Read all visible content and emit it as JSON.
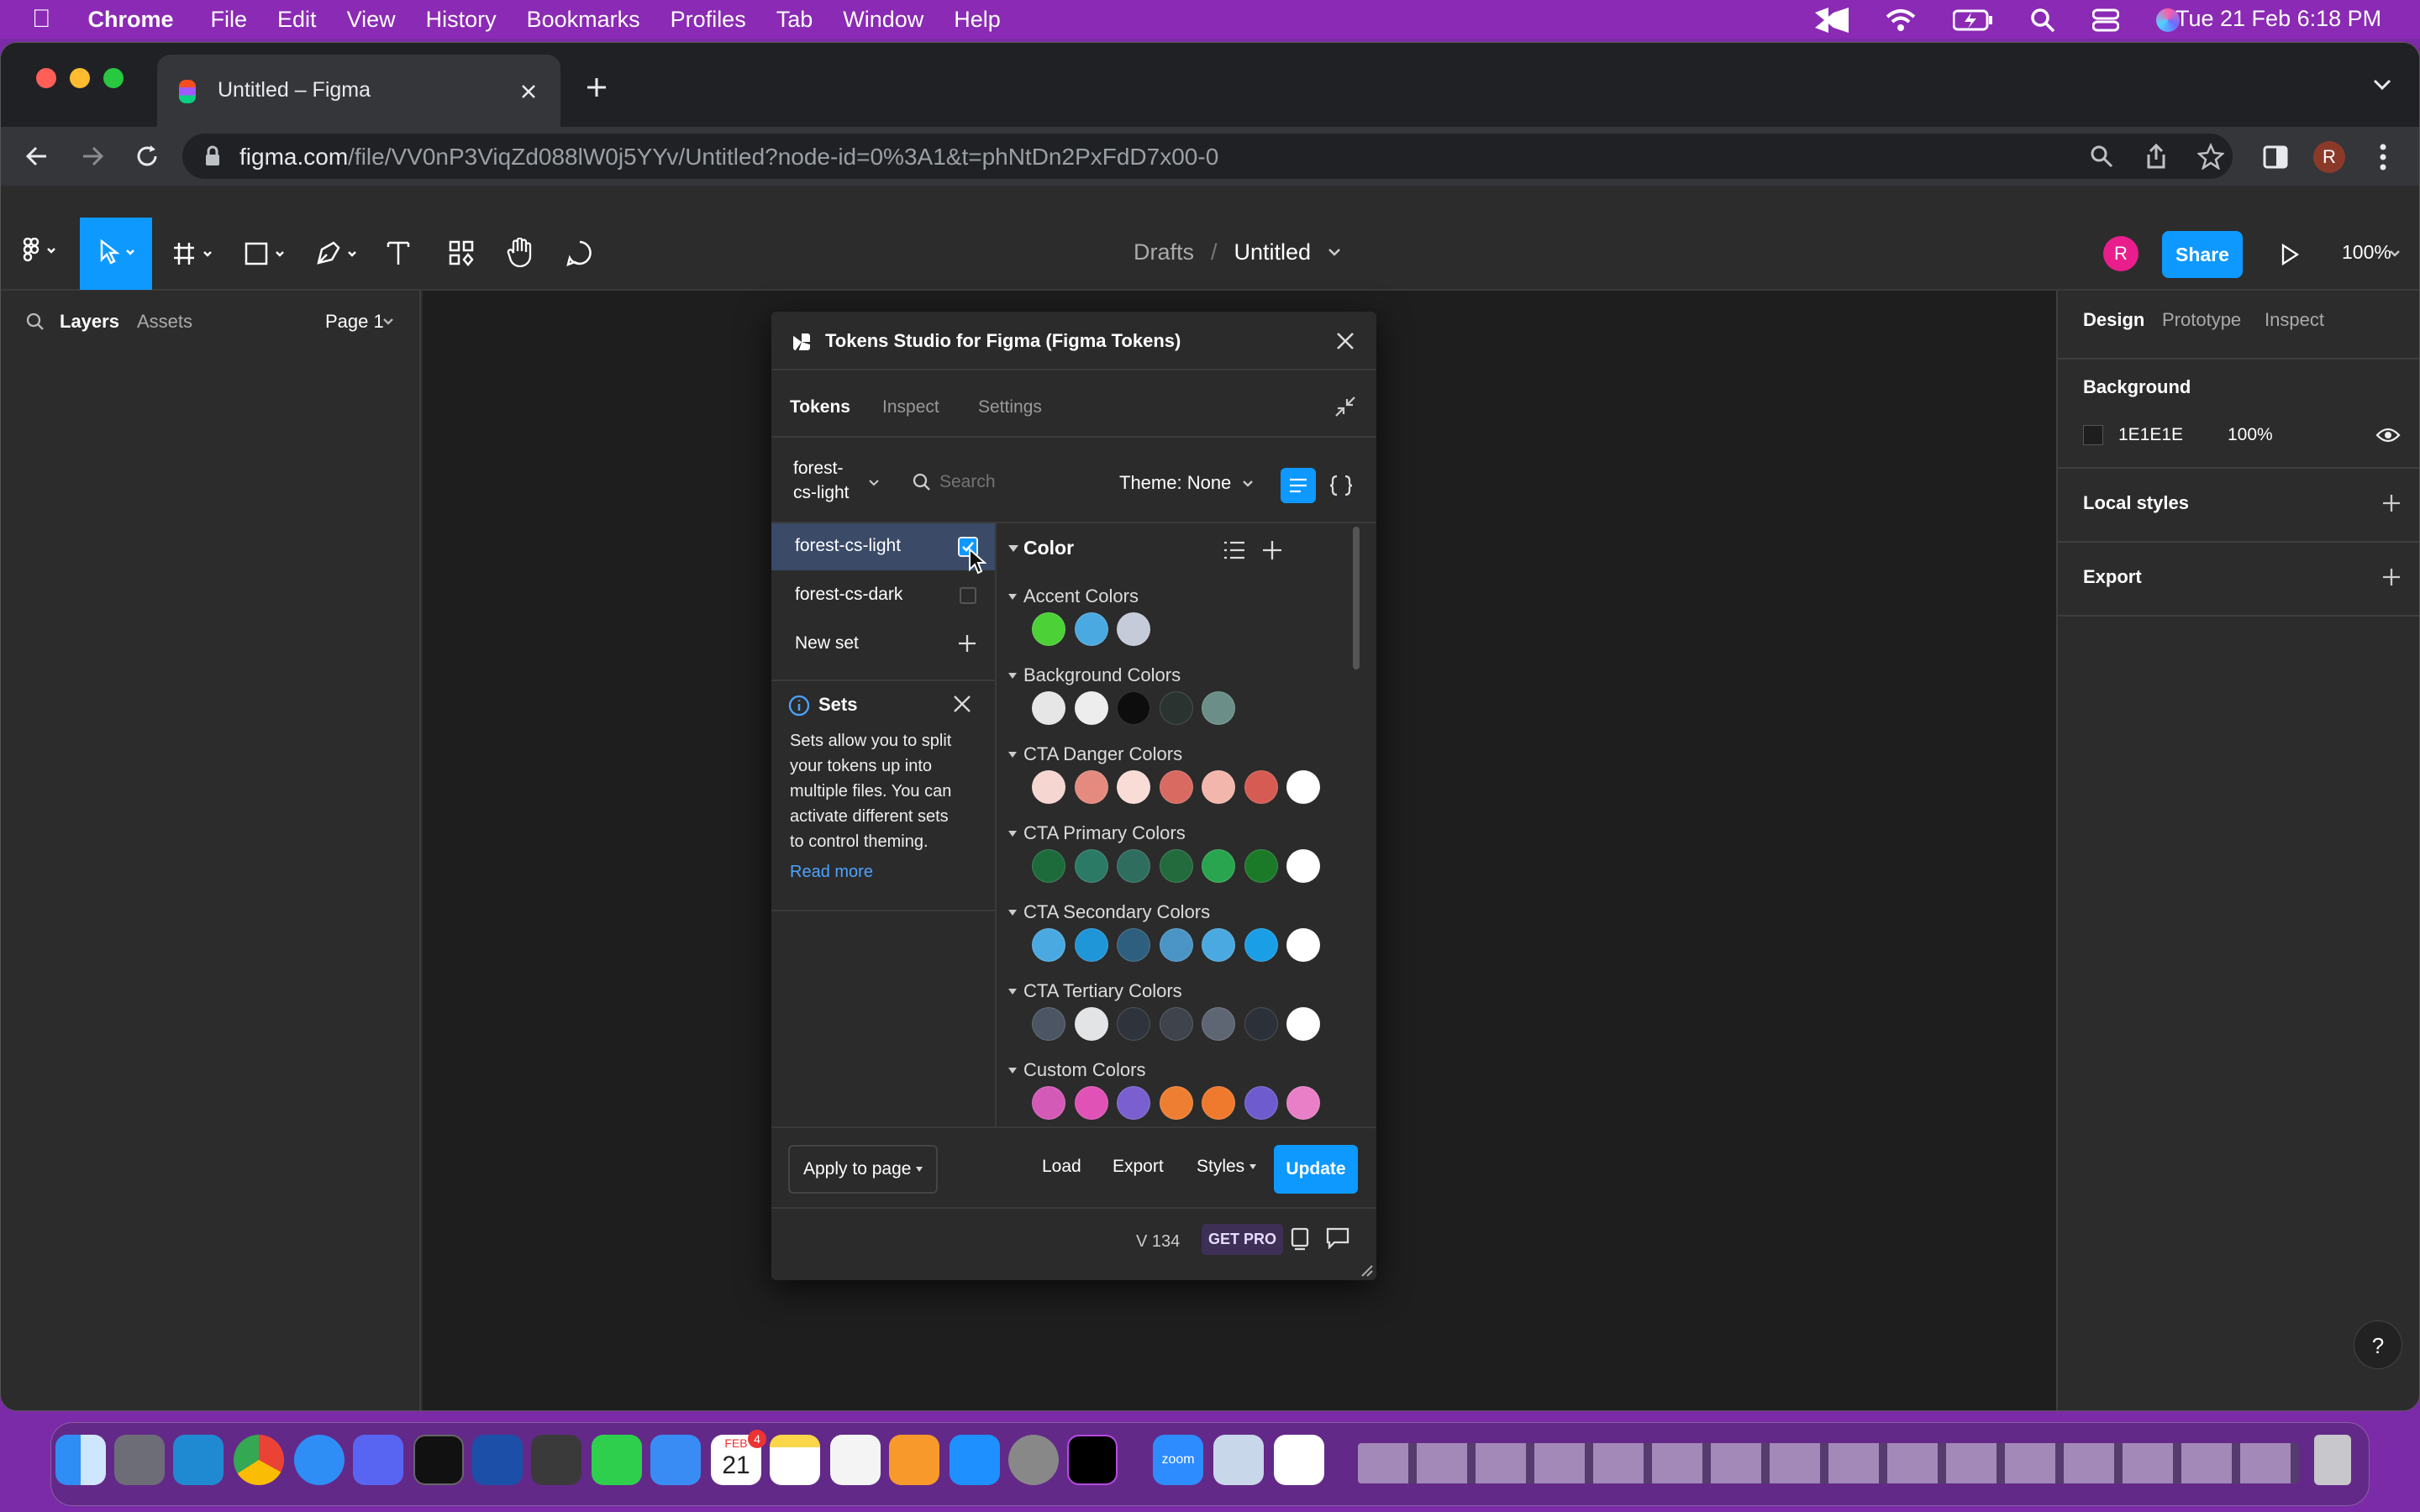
{
  "menubar": {
    "app": "Chrome",
    "items": [
      "File",
      "Edit",
      "View",
      "History",
      "Bookmarks",
      "Profiles",
      "Tab",
      "Window",
      "Help"
    ],
    "datetime": "Tue 21 Feb  6:18 PM"
  },
  "browser": {
    "tab_title": "Untitled – Figma",
    "url_domain": "figma.com",
    "url_path": "/file/VV0nP3ViqZd088lW0j5YYv/Untitled?node-id=0%3A1&t=phNtDn2PxFdD7x00-0",
    "profile_initial": "R"
  },
  "figma": {
    "breadcrumb_parent": "Drafts",
    "breadcrumb_sep": "/",
    "file_name": "Untitled",
    "avatar_initial": "R",
    "share_label": "Share",
    "zoom": "100%",
    "left_tabs": [
      "Layers",
      "Assets"
    ],
    "page_label": "Page 1",
    "right_tabs": [
      "Design",
      "Prototype",
      "Inspect"
    ],
    "background_heading": "Background",
    "bg_hex": "1E1E1E",
    "bg_opacity": "100%",
    "local_styles": "Local styles",
    "export": "Export",
    "help": "?"
  },
  "plugin": {
    "title": "Tokens Studio for Figma (Figma Tokens)",
    "tabs": [
      "Tokens",
      "Inspect",
      "Settings"
    ],
    "set_selector_line1": "forest-",
    "set_selector_line2": "cs-light",
    "search_placeholder": "Search",
    "theme_label": "Theme: None",
    "sets": [
      {
        "name": "forest-cs-light",
        "checked": true
      },
      {
        "name": "forest-cs-dark",
        "checked": false
      }
    ],
    "new_set": "New set",
    "info_title": "Sets",
    "info_text": "Sets allow you to split your tokens up into multiple files. You can activate different sets to control theming.",
    "info_lines": [
      "Sets allow you to split",
      "your tokens up into",
      "multiple files. You can",
      "activate different sets",
      "to control theming."
    ],
    "read_more": "Read more",
    "section": "Color",
    "groups": [
      {
        "name": "Accent Colors",
        "colors": [
          "#4cd137",
          "#4aa9e0",
          "#c5cbd8"
        ]
      },
      {
        "name": "Background Colors",
        "colors": [
          "#e6e6e6",
          "#ededed",
          "#0d0d0d",
          "#2a3330",
          "#6b8f88"
        ]
      },
      {
        "name": "CTA Danger Colors",
        "colors": [
          "#f6d6d0",
          "#e58a7f",
          "#f9dcd6",
          "#d96a62",
          "#f3b6ad",
          "#d65b52",
          "#ffffff"
        ]
      },
      {
        "name": "CTA Primary Colors",
        "colors": [
          "#1d6b3a",
          "#2b7a66",
          "#2f6e5e",
          "#236b3d",
          "#2aa54f",
          "#1b7a28",
          "#ffffff"
        ]
      },
      {
        "name": "CTA Secondary Colors",
        "colors": [
          "#4aa9e0",
          "#1f96d8",
          "#2f5f7e",
          "#4a95c6",
          "#4aa9e0",
          "#1a9ee6",
          "#ffffff"
        ]
      },
      {
        "name": "CTA Tertiary Colors",
        "colors": [
          "#4b5564",
          "#e3e4e6",
          "#2f343c",
          "#3f434b",
          "#5f6673",
          "#2c3038",
          "#ffffff"
        ]
      },
      {
        "name": "Custom Colors",
        "colors": [
          "#d45ab8",
          "#e052b5",
          "#7a5fd0",
          "#ee7f32",
          "#ef7a2e",
          "#6e5ccf",
          "#e87fc7"
        ]
      }
    ],
    "footer": {
      "apply": "Apply to page",
      "load": "Load",
      "export": "Export",
      "styles": "Styles",
      "update": "Update",
      "version": "V 134",
      "get_pro": "GET PRO"
    }
  },
  "dock": {
    "calendar_month": "FEB",
    "calendar_day": "21",
    "calendar_badge": "4",
    "zoom_label": "zoom"
  }
}
